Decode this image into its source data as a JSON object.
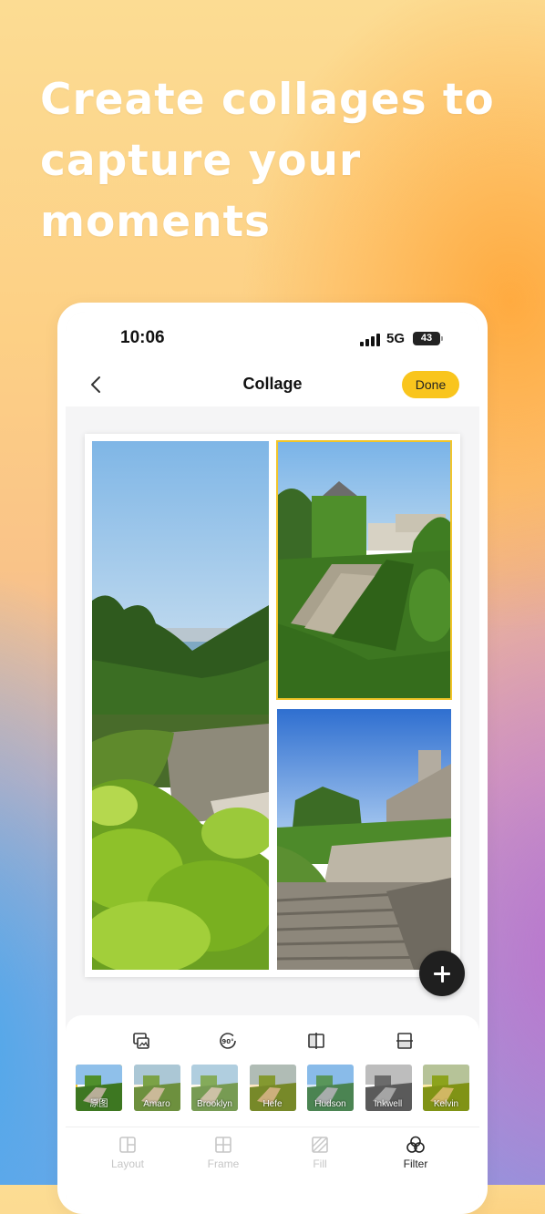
{
  "headline": "Create collages to capture your moments",
  "status": {
    "time": "10:06",
    "network": "5G",
    "battery": "43"
  },
  "nav": {
    "title": "Collage",
    "done_label": "Done"
  },
  "toolbar_icons": [
    "replace-photo-icon",
    "rotate-90-icon",
    "flip-horizontal-icon",
    "flip-vertical-icon"
  ],
  "rotate_badge": "90°",
  "filters": [
    {
      "label": "原图",
      "selected": true
    },
    {
      "label": "Amaro",
      "selected": false
    },
    {
      "label": "Brooklyn",
      "selected": false
    },
    {
      "label": "Hefe",
      "selected": false
    },
    {
      "label": "Hudson",
      "selected": false
    },
    {
      "label": "Inkwell",
      "selected": false
    },
    {
      "label": "Kelvin",
      "selected": false
    }
  ],
  "tabs": [
    {
      "label": "Layout",
      "icon": "layout-icon",
      "active": false
    },
    {
      "label": "Frame",
      "icon": "frame-icon",
      "active": false
    },
    {
      "label": "Fill",
      "icon": "fill-icon",
      "active": false
    },
    {
      "label": "Filter",
      "icon": "filter-icon",
      "active": true
    }
  ],
  "colors": {
    "accent": "#f9c51d",
    "selection": "#f2c52a",
    "fab": "#1f1f1f"
  }
}
